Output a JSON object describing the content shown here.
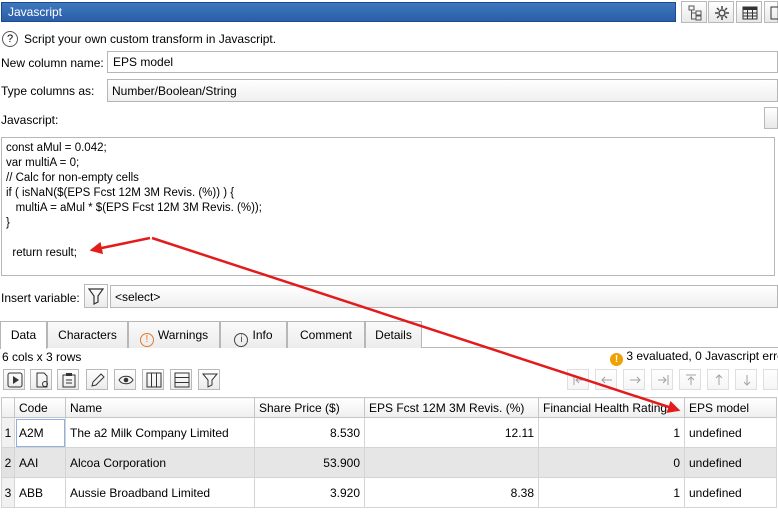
{
  "header": {
    "title": "Javascript"
  },
  "help": {
    "text": "Script your own custom transform in Javascript."
  },
  "form": {
    "column_name_label": "New column name:",
    "column_name_value": "EPS model",
    "type_label": "Type columns as:",
    "type_value": "Number/Boolean/String",
    "script_label": "Javascript:",
    "insert_label": "Insert variable:",
    "insert_value": "<select>"
  },
  "code": {
    "lines": [
      "const aMul = 0.042;",
      "var multiA = 0;",
      "// Calc for non-empty cells",
      "if ( isNaN($(EPS Fcst 12M 3M Revis. (%)) ) {",
      "   multiA = aMul * $(EPS Fcst 12M 3M Revis. (%));",
      "}",
      "",
      "  return result;"
    ]
  },
  "tabs": [
    {
      "label": "Data",
      "active": true
    },
    {
      "label": "Characters"
    },
    {
      "label": "Warnings",
      "icon": "warning-icon"
    },
    {
      "label": "Info",
      "icon": "info-icon"
    },
    {
      "label": "Comment"
    },
    {
      "label": "Details"
    }
  ],
  "status": {
    "dims": "6 cols x 3 rows",
    "eval": "3 evaluated, 0 Javascript erro"
  },
  "table": {
    "columns": [
      "Code",
      "Name",
      "Share Price ($)",
      "EPS Fcst 12M 3M Revis. (%)",
      "Financial Health Rating",
      "EPS model"
    ],
    "rows": [
      {
        "n": "1",
        "cells": [
          "A2M",
          "The a2 Milk Company Limited",
          "8.530",
          "12.11",
          "1",
          "undefined"
        ]
      },
      {
        "n": "2",
        "cells": [
          "AAI",
          "Alcoa Corporation",
          "53.900",
          "",
          "0",
          "undefined"
        ]
      },
      {
        "n": "3",
        "cells": [
          "ABB",
          "Aussie Broadband Limited",
          "3.920",
          "8.38",
          "1",
          "undefined"
        ]
      }
    ]
  },
  "colors": {
    "title_bar": "#2f67b0",
    "annotation_arrow": "#e21b1b",
    "warning_orange": "#f0a000"
  }
}
